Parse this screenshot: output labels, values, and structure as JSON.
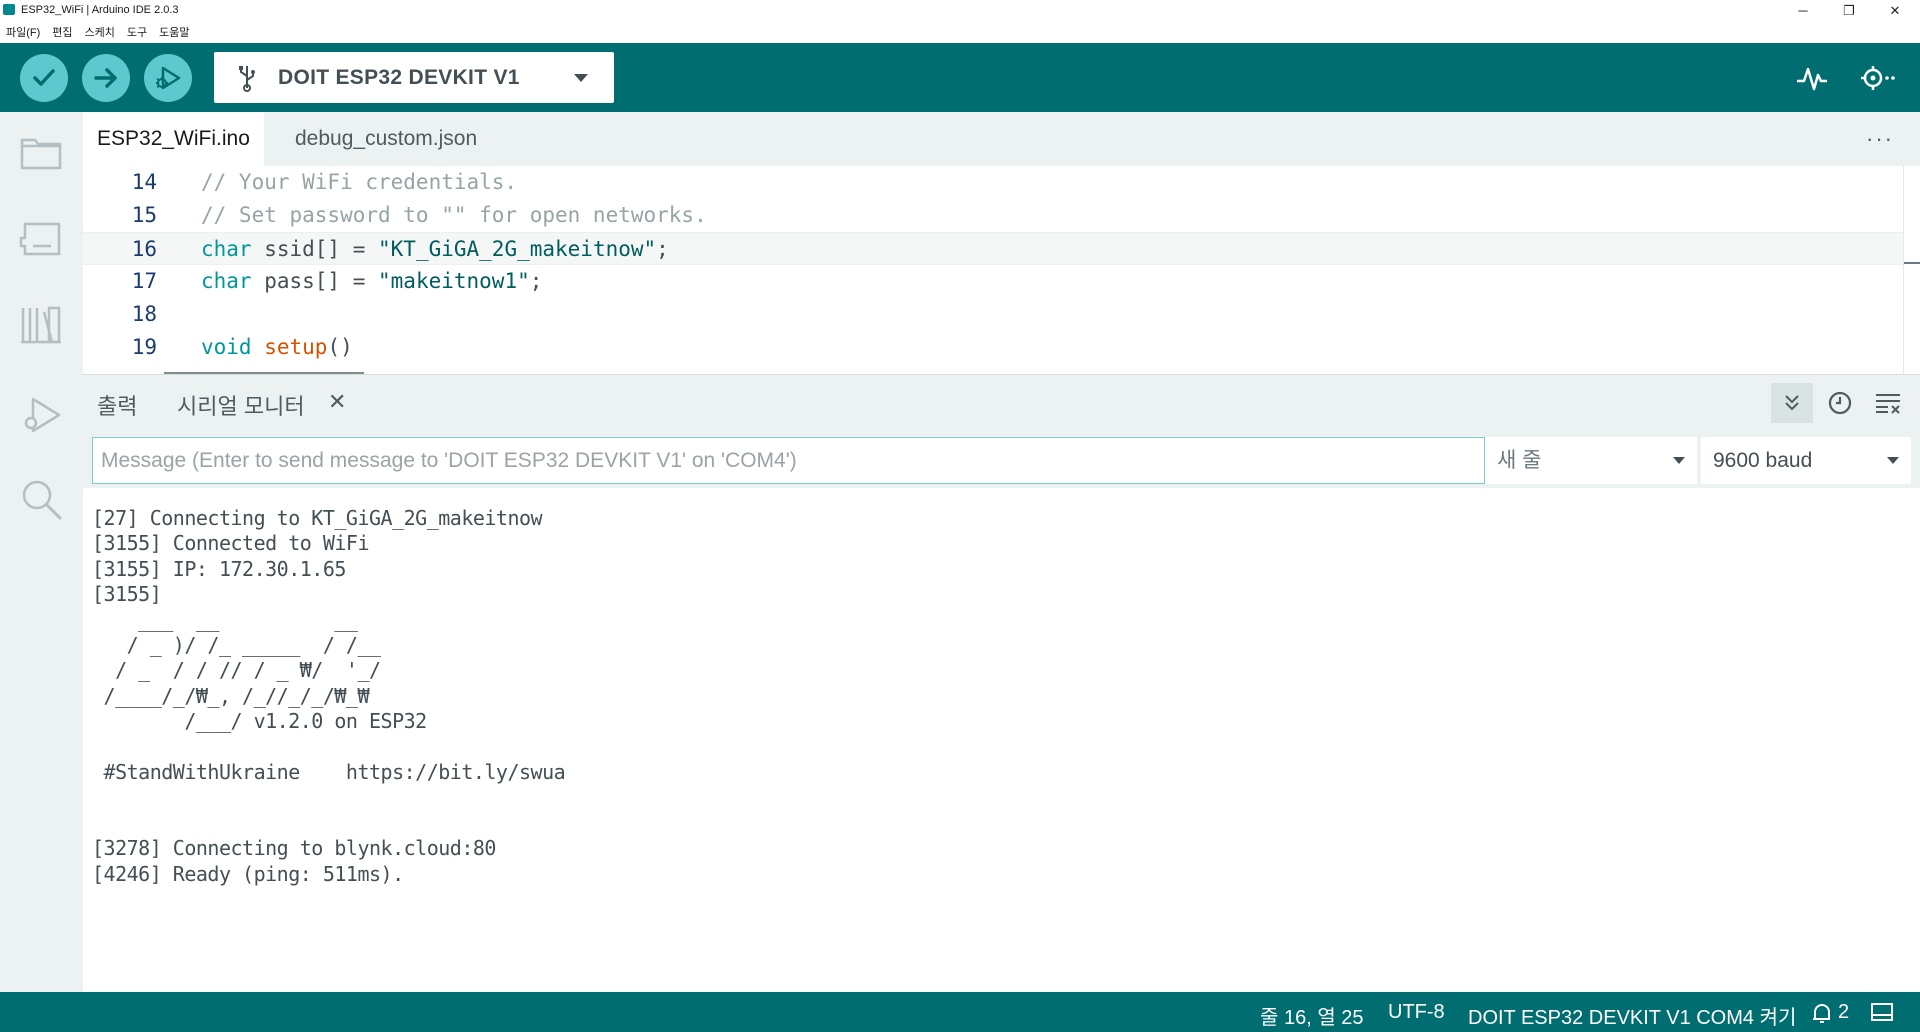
{
  "window": {
    "title": "ESP32_WiFi | Arduino IDE 2.0.3",
    "controls": {
      "minimize": "─",
      "restore": "❐",
      "close": "✕"
    }
  },
  "menu": [
    "파일(F)",
    "편집",
    "스케치",
    "도구",
    "도움말"
  ],
  "toolbar": {
    "verify_icon": "check-icon",
    "upload_icon": "arrow-right-icon",
    "debug_icon": "debug-icon",
    "board": "DOIT ESP32 DEVKIT V1",
    "plotter_icon": "serial-plotter-icon",
    "monitor_icon": "serial-monitor-icon"
  },
  "sidebar": [
    "folder-icon",
    "board-icon",
    "library-icon",
    "debug-icon",
    "search-icon"
  ],
  "tabs": [
    {
      "label": "ESP32_WiFi.ino",
      "active": true
    },
    {
      "label": "debug_custom.json",
      "active": false
    }
  ],
  "tabs_more": "···",
  "editor": {
    "lines": [
      {
        "num": "14",
        "tokens": [
          [
            "c-com",
            "// Your WiFi credentials."
          ]
        ]
      },
      {
        "num": "15",
        "tokens": [
          [
            "c-com",
            "// Set password to \"\" for open networks."
          ]
        ]
      },
      {
        "num": "16",
        "current": true,
        "tokens": [
          [
            "c-kw",
            "char"
          ],
          [
            "c-txt",
            " ssid[] = "
          ],
          [
            "c-str",
            "\"KT_GiGA_2G_makeitnow\""
          ],
          [
            "c-txt",
            ";"
          ]
        ]
      },
      {
        "num": "17",
        "tokens": [
          [
            "c-kw",
            "char"
          ],
          [
            "c-txt",
            " pass[] = "
          ],
          [
            "c-str",
            "\"makeitnow1\""
          ],
          [
            "c-txt",
            ";"
          ]
        ]
      },
      {
        "num": "18",
        "tokens": []
      },
      {
        "num": "19",
        "tokens": [
          [
            "c-kw",
            "void"
          ],
          [
            "c-txt",
            " "
          ],
          [
            "c-fn",
            "setup"
          ],
          [
            "c-txt",
            "()"
          ]
        ]
      }
    ]
  },
  "panel": {
    "tab_output": "출력",
    "tab_serial": "시리얼 모니터",
    "close": "✕"
  },
  "serial": {
    "placeholder": "Message (Enter to send message to 'DOIT ESP32 DEVKIT V1' on 'COM4')",
    "line_ending": "새 줄",
    "baud": "9600 baud",
    "output": [
      "[27] Connecting to KT_GiGA_2G_makeitnow",
      "[3155] Connected to WiFi",
      "[3155] IP: 172.30.1.65",
      "[3155]",
      "    ___  __          __",
      "   / _ )/ /_ _____  / /__",
      "  / _  / / // / _ ₩/  '_/",
      " /____/_/₩_, /_//_/_/₩_₩",
      "        /___/ v1.2.0 on ESP32",
      "",
      " #StandWithUkraine    https://bit.ly/swua",
      "",
      "",
      "[3278] Connecting to blynk.cloud:80",
      "[4246] Ready (ping: 511ms)."
    ]
  },
  "status": {
    "position": "줄 16, 열 25",
    "encoding": "UTF-8",
    "board_port": "DOIT ESP32 DEVKIT V1 COM4 켜기",
    "notifications": "2"
  }
}
